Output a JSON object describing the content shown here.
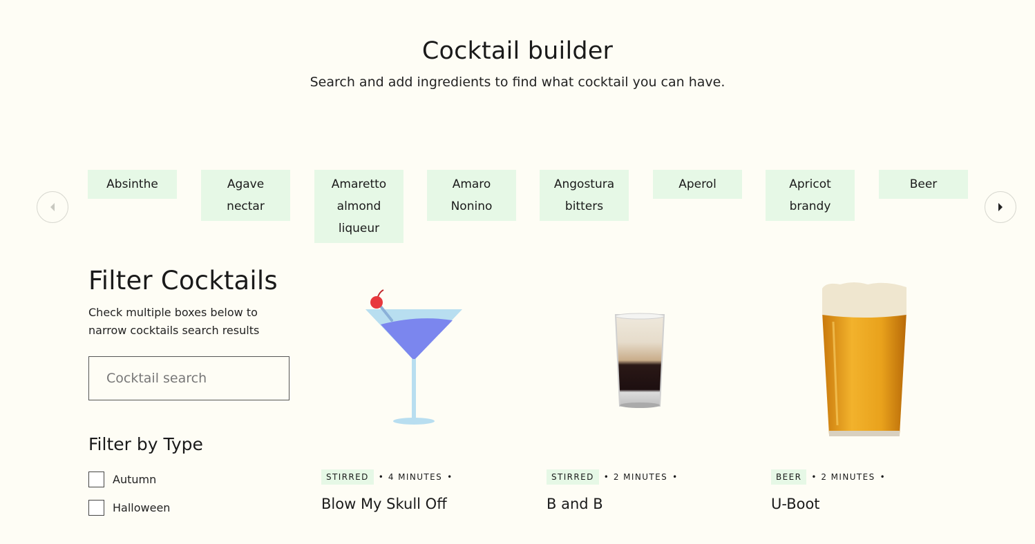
{
  "header": {
    "title": "Cocktail builder",
    "subtitle": "Search and add ingredients to find what cocktail you can have."
  },
  "carousel": {
    "ingredients": [
      "Absinthe",
      "Agave nectar",
      "Amaretto almond liqueur",
      "Amaro Nonino",
      "Angostura bitters",
      "Aperol",
      "Apricot brandy",
      "Beer"
    ],
    "prev_icon": "chevron-left-icon",
    "next_icon": "chevron-right-icon"
  },
  "filters": {
    "title": "Filter Cocktails",
    "description": "Check multiple boxes below to narrow cocktails search results",
    "search_placeholder": "Cocktail search",
    "type_title": "Filter by Type",
    "types": [
      "Autumn",
      "Halloween"
    ]
  },
  "cocktails": [
    {
      "method": "STIRRED",
      "time": "4 MINUTES",
      "name": "Blow My Skull Off",
      "image": "martini-glass-icon"
    },
    {
      "method": "STIRRED",
      "time": "2 MINUTES",
      "name": "B and B",
      "image": "shot-glass-icon"
    },
    {
      "method": "BEER",
      "time": "2 MINUTES",
      "name": "U-Boot",
      "image": "beer-pint-icon"
    }
  ],
  "colors": {
    "background": "#fefdf5",
    "chip": "#e6f8e6",
    "martini_liquid": "#7b86ee",
    "martini_glass": "#b8def0",
    "cherry": "#e8383d",
    "beer": "#e9a21c"
  }
}
